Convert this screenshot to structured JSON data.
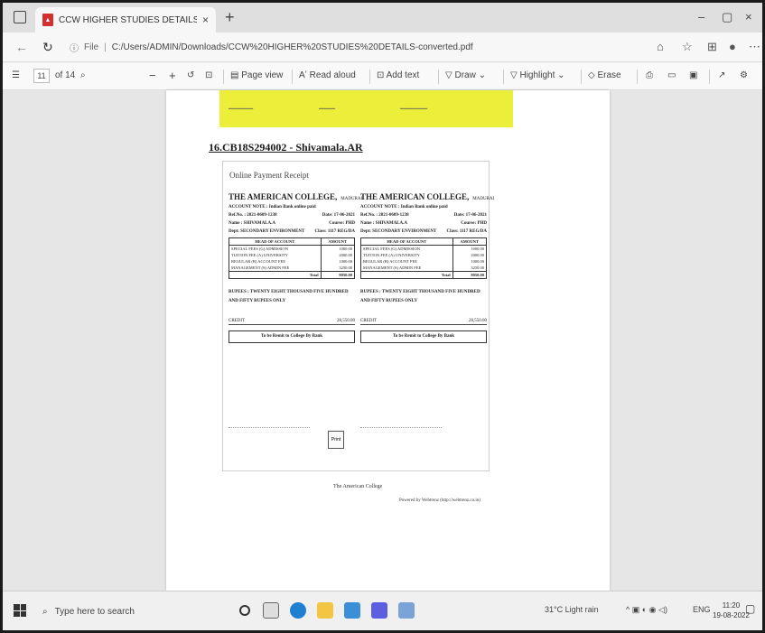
{
  "browser": {
    "tab_title": "CCW HIGHER STUDIES DETAILS -",
    "url_prefix": "File",
    "url": "C:/Users/ADMIN/Downloads/CCW%20HIGHER%20STUDIES%20DETAILS-converted.pdf",
    "new_tab_symbol": "+",
    "minimize": "–",
    "maximize": "▢",
    "close": "×"
  },
  "pdf_toolbar": {
    "page_current": "11",
    "page_total": "of 14",
    "page_view": "Page view",
    "read_aloud": "Read aloud",
    "add_text": "Add text",
    "draw": "Draw",
    "highlight": "Highlight",
    "erase": "Erase"
  },
  "document": {
    "student_id": "16.CB18S294002 - Shivamala.AR",
    "receipt_title": "Online Payment Receipt",
    "left_copy": {
      "college": "THE AMERICAN COLLEGE,",
      "place": "MADURAI",
      "account_note": "ACCOUNT NOTE : Indian Bank online paid",
      "ref": "Ref.No. : 2021-0609-1238",
      "date": "Date: 17-06-2021",
      "name": "Name : SHIVAMALA.A",
      "course": "Course: PHD",
      "dept": "Dept: SECONDARY ENVIRONMENT",
      "cls": "Class: 1117 REG/DA",
      "head": "HEAD OF ACCOUNT",
      "amount": "AMOUNT",
      "items": [
        {
          "head": "SPECIAL FEES (G) ADMISSION",
          "amt": "1000.00"
        },
        {
          "head": "TUITION FEE (A) UNIVERSITY",
          "amt": "2000.00"
        },
        {
          "head": "REGULAR (B) ACCOUNT FEE",
          "amt": "1000.00"
        },
        {
          "head": "MANAGEMENT (S) ADMIN FEE",
          "amt": "3250.00"
        }
      ],
      "total_label": "Total",
      "total": "8050.00",
      "rupees": "RUPEES : TWENTY EIGHT THOUSAND FIVE HUNDRED AND FIFTY RUPEES ONLY",
      "credit": "CREDIT",
      "credit_amt": "28,550.00",
      "remit": "To be Remit to College By Bank"
    },
    "right_copy": {
      "college": "THE AMERICAN COLLEGE,",
      "place": "MADURAI",
      "account_note": "ACCOUNT NOTE : Indian Bank online paid",
      "ref": "Ref.No. : 2021-0609-1238",
      "date": "Date: 17-06-2021",
      "name": "Name : SHIVAMALA.A",
      "course": "Course: PHD",
      "dept": "Dept: SECONDARY ENVIRONMENT",
      "cls": "Class: 1117 REG/DA",
      "head": "HEAD OF ACCOUNT",
      "amount": "AMOUNT",
      "items": [
        {
          "head": "SPECIAL FEES (G) ADMISSION",
          "amt": "1000.00"
        },
        {
          "head": "TUITION FEE (A) UNIVERSITY",
          "amt": "2000.00"
        },
        {
          "head": "REGULAR (B) ACCOUNT FEE",
          "amt": "1000.00"
        },
        {
          "head": "MANAGEMENT (S) ADMIN FEE",
          "amt": "3250.00"
        }
      ],
      "total_label": "Total",
      "total": "8050.00",
      "rupees": "RUPEES : TWENTY EIGHT THOUSAND FIVE HUNDRED AND FIFTY RUPEES ONLY",
      "credit": "CREDIT",
      "credit_amt": "28,550.00",
      "remit": "To be Remit to College By Bank"
    },
    "print_label": "Print",
    "footer_college": "The American College",
    "footer_url": "Powered by Webtrenz (http://webtrenz.co.in)"
  },
  "taskbar": {
    "search_placeholder": "Type here to search",
    "weather": "31°C  Light rain",
    "lang": "ENG",
    "time": "11:20",
    "date": "19-08-2022"
  }
}
